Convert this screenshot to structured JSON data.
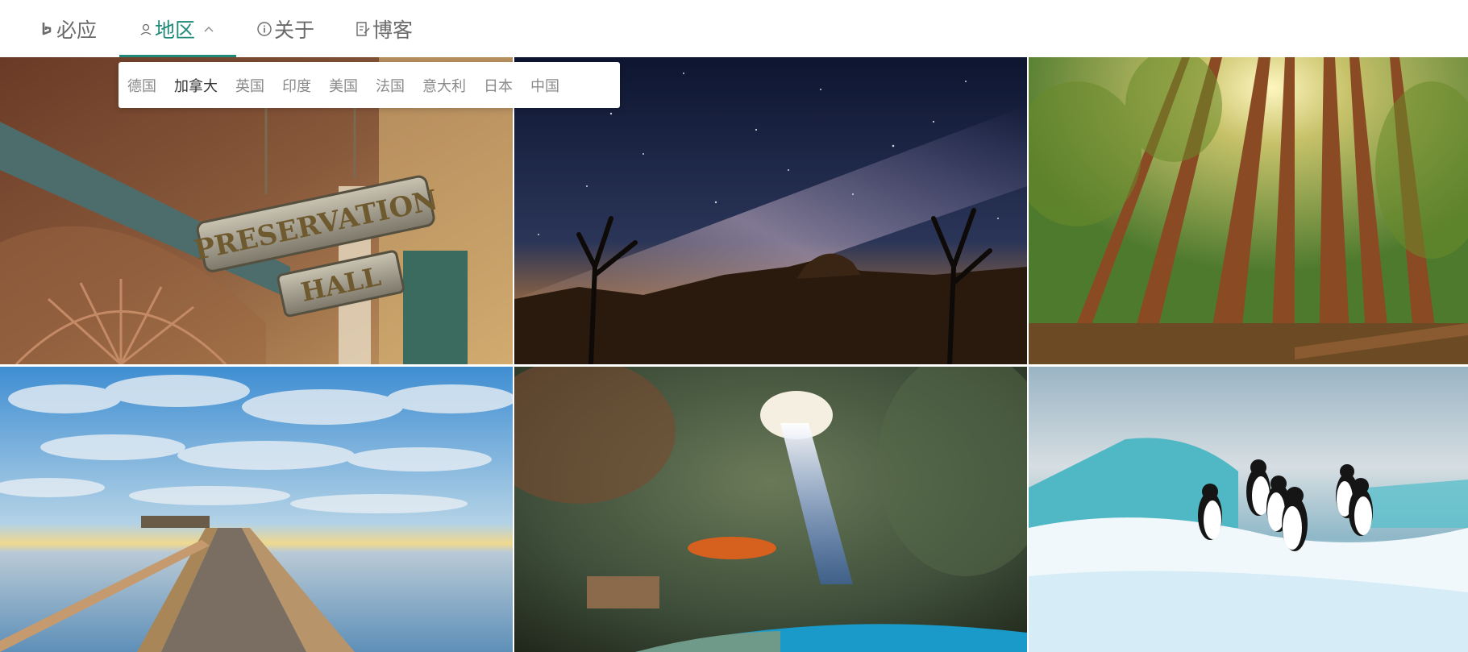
{
  "nav": {
    "brand_label": "必应",
    "region_label": "地区",
    "about_label": "关于",
    "blog_label": "博客"
  },
  "region_dropdown": {
    "options": [
      "德国",
      "加拿大",
      "英国",
      "印度",
      "美国",
      "法国",
      "意大利",
      "日本",
      "中国"
    ],
    "selected": "加拿大"
  },
  "colors": {
    "accent": "#1f8a7a",
    "nav_text": "#6b6b6b",
    "dropdown_text": "#8a8a8a",
    "dropdown_selected_text": "#333333"
  },
  "photos": {
    "sign_1": "PRESERVATION",
    "sign_2": "HALL"
  }
}
